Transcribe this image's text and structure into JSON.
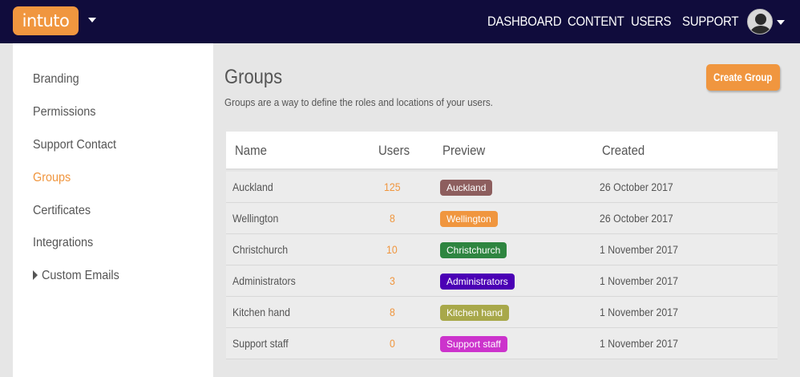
{
  "header": {
    "logo_text": "intuto",
    "nav": [
      "DASHBOARD",
      "CONTENT",
      "USERS",
      "SUPPORT"
    ]
  },
  "sidebar": {
    "items": [
      {
        "label": "Branding"
      },
      {
        "label": "Permissions"
      },
      {
        "label": "Support Contact"
      },
      {
        "label": "Groups",
        "active": true
      },
      {
        "label": "Certificates"
      },
      {
        "label": "Integrations"
      },
      {
        "label": "Custom Emails"
      }
    ]
  },
  "main": {
    "title": "Groups",
    "subtitle": "Groups are a way to define the roles and locations of your users.",
    "create_label": "Create Group"
  },
  "table": {
    "columns": [
      "Name",
      "Users",
      "Preview",
      "Created"
    ],
    "rows": [
      {
        "name": "Auckland",
        "users": "125",
        "preview": "Auckland",
        "color": "#8d5e5e",
        "created": "26 October 2017"
      },
      {
        "name": "Wellington",
        "users": "8",
        "preview": "Wellington",
        "color": "#f0963f",
        "created": "26 October 2017"
      },
      {
        "name": "Christchurch",
        "users": "10",
        "preview": "Christchurch",
        "color": "#2e8540",
        "created": "1 November 2017"
      },
      {
        "name": "Administrators",
        "users": "3",
        "preview": "Administrators",
        "color": "#4b00b5",
        "created": "1 November 2017"
      },
      {
        "name": "Kitchen hand",
        "users": "8",
        "preview": "Kitchen hand",
        "color": "#a8a84a",
        "created": "1 November 2017"
      },
      {
        "name": "Support staff",
        "users": "0",
        "preview": "Support staff",
        "color": "#cc33cc",
        "created": "1 November 2017"
      }
    ]
  },
  "colors": {
    "accent": "#f0963f",
    "topbar": "#100c3c"
  }
}
